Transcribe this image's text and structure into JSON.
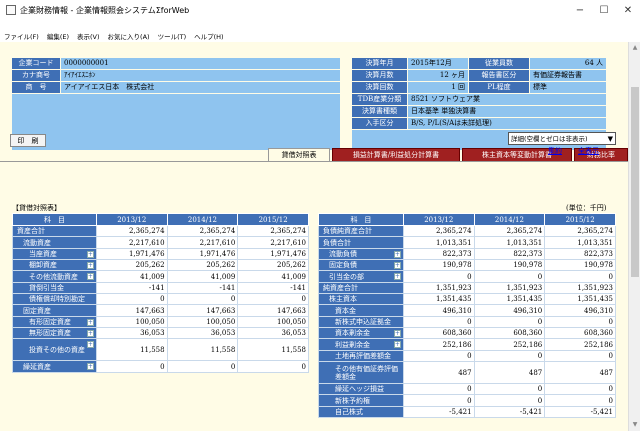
{
  "window": {
    "title": "企業財務情報 - 企業情報照会システムΣforWeb",
    "min": "−",
    "max": "☐",
    "close": "✕"
  },
  "menu": [
    "ファイル(F)",
    "編集(E)",
    "表示(V)",
    "お気に入り(A)",
    "ツール(T)",
    "ヘルプ(H)"
  ],
  "company": {
    "labels": [
      "企業コード",
      "カナ商号",
      "商　号"
    ],
    "values": [
      "0000000001",
      "ｱｲｱｲｴｽﾆﾎﾝ",
      "アイアイエス日本　株式会社"
    ]
  },
  "settlement": {
    "labels": [
      "決算年月",
      "決算月数",
      "決算回数",
      "TDB産業分類",
      "決算書種類",
      "入手区分"
    ],
    "values": [
      "2015年12月",
      "12 ヶ月",
      "1 回",
      "8521 ソフトウェア業",
      "日本基準 単独決算書",
      "B/S, P/L(S/Aは未詳処理)"
    ],
    "right_labels": [
      "従業員数",
      "報告書区分",
      "PL程度"
    ],
    "right_values": [
      "64 人",
      "有価証券報告書",
      "標準"
    ]
  },
  "tabs": [
    "貸借対照表",
    "損益計算書/利益処分計算書",
    "株主資本等変動計算書",
    "財務比率"
  ],
  "toolbar": {
    "print": "印　刷",
    "select_value": "詳細(空欄とゼロは非表示)",
    "link_summary": "集約",
    "link_all": "全表示"
  },
  "section_title": "【貸借対照表】",
  "unit": "(単位：千円)",
  "left_table": {
    "headers": [
      "科　目",
      "2013/12",
      "2014/12",
      "2015/12"
    ],
    "rows": [
      {
        "name": "資産合計",
        "level": 1,
        "plus": false,
        "v": [
          "2,365,274",
          "2,365,274",
          "2,365,274"
        ]
      },
      {
        "name": "流動資産",
        "level": 2,
        "plus": false,
        "v": [
          "2,217,610",
          "2,217,610",
          "2,217,610"
        ]
      },
      {
        "name": "当座資産",
        "level": 3,
        "plus": true,
        "v": [
          "1,971,476",
          "1,971,476",
          "1,971,476"
        ]
      },
      {
        "name": "棚卸資産",
        "level": 3,
        "plus": true,
        "v": [
          "205,262",
          "205,262",
          "205,262"
        ]
      },
      {
        "name": "その他流動資産",
        "level": 3,
        "plus": true,
        "v": [
          "41,009",
          "41,009",
          "41,009"
        ]
      },
      {
        "name": "貸倒引当金",
        "level": 3,
        "plus": false,
        "v": [
          "-141",
          "-141",
          "-141"
        ]
      },
      {
        "name": "債権償却特別勘定",
        "level": 3,
        "plus": false,
        "v": [
          "0",
          "0",
          "0"
        ]
      },
      {
        "name": "固定資産",
        "level": 2,
        "plus": false,
        "v": [
          "147,663",
          "147,663",
          "147,663"
        ]
      },
      {
        "name": "有形固定資産",
        "level": 3,
        "plus": true,
        "v": [
          "100,050",
          "100,050",
          "100,050"
        ]
      },
      {
        "name": "無形固定資産",
        "level": 3,
        "plus": true,
        "v": [
          "36,053",
          "36,053",
          "36,053"
        ]
      },
      {
        "name": "投資その他の資産",
        "level": 3,
        "plus": true,
        "two": true,
        "v": [
          "11,558",
          "11,558",
          "11,558"
        ]
      },
      {
        "name": "繰延資産",
        "level": 2,
        "plus": true,
        "v": [
          "0",
          "0",
          "0"
        ]
      }
    ]
  },
  "right_table": {
    "headers": [
      "科　目",
      "2013/12",
      "2014/12",
      "2015/12"
    ],
    "rows": [
      {
        "name": "負債純資産合計",
        "level": 1,
        "plus": false,
        "v": [
          "2,365,274",
          "2,365,274",
          "2,365,274"
        ]
      },
      {
        "name": "負債合計",
        "level": 1,
        "plus": false,
        "v": [
          "1,013,351",
          "1,013,351",
          "1,013,351"
        ]
      },
      {
        "name": "流動負債",
        "level": 2,
        "plus": true,
        "v": [
          "822,373",
          "822,373",
          "822,373"
        ]
      },
      {
        "name": "固定負債",
        "level": 2,
        "plus": true,
        "v": [
          "190,978",
          "190,978",
          "190,978"
        ]
      },
      {
        "name": "引当金の部",
        "level": 2,
        "plus": true,
        "v": [
          "0",
          "0",
          "0"
        ]
      },
      {
        "name": "純資産合計",
        "level": 1,
        "plus": false,
        "v": [
          "1,351,923",
          "1,351,923",
          "1,351,923"
        ]
      },
      {
        "name": "株主資本",
        "level": 2,
        "plus": false,
        "v": [
          "1,351,435",
          "1,351,435",
          "1,351,435"
        ]
      },
      {
        "name": "資本金",
        "level": 3,
        "plus": false,
        "v": [
          "496,310",
          "496,310",
          "496,310"
        ]
      },
      {
        "name": "新株式申込証拠金",
        "level": 3,
        "plus": false,
        "v": [
          "0",
          "0",
          "0"
        ]
      },
      {
        "name": "資本剰余金",
        "level": 3,
        "plus": true,
        "v": [
          "608,360",
          "608,360",
          "608,360"
        ]
      },
      {
        "name": "利益剰余金",
        "level": 3,
        "plus": true,
        "v": [
          "252,186",
          "252,186",
          "252,186"
        ]
      },
      {
        "name": "土地再評価差額金",
        "level": 3,
        "plus": false,
        "v": [
          "0",
          "0",
          "0"
        ]
      },
      {
        "name": "その他有価証券評価差額金",
        "level": 3,
        "plus": false,
        "two": true,
        "v": [
          "487",
          "487",
          "487"
        ]
      },
      {
        "name": "繰延ヘッジ損益",
        "level": 3,
        "plus": false,
        "v": [
          "0",
          "0",
          "0"
        ]
      },
      {
        "name": "新株予約権",
        "level": 3,
        "plus": false,
        "v": [
          "0",
          "0",
          "0"
        ]
      },
      {
        "name": "自己株式",
        "level": 3,
        "plus": false,
        "v": [
          "-5,421",
          "-5,421",
          "-5,421"
        ]
      }
    ]
  }
}
